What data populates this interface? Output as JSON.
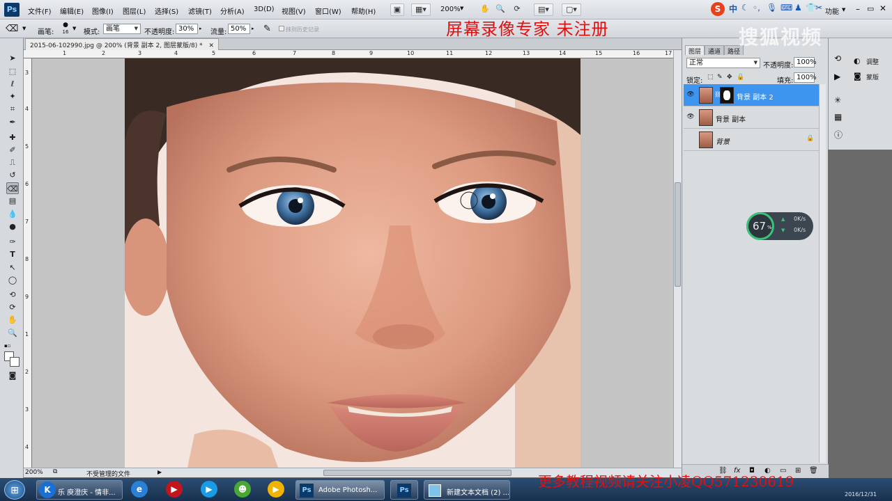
{
  "app": {
    "logo": "Ps"
  },
  "menubar": {
    "items": [
      "文件(F)",
      "编辑(E)",
      "图像(I)",
      "图层(L)",
      "选择(S)",
      "滤镜(T)",
      "分析(A)",
      "3D(D)",
      "视图(V)",
      "窗口(W)",
      "帮助(H)"
    ],
    "zoom": "200%",
    "right_label": "功能"
  },
  "options": {
    "tool_label": "画笔:",
    "brush_size": "16",
    "mode_label": "模式:",
    "mode_value": "画笔",
    "opacity_label": "不透明度:",
    "opacity_value": "30%",
    "flow_label": "流量:",
    "flow_value": "50%",
    "history_label": "抹到历史记录"
  },
  "watermark_top": "屏幕录像专家  未注册",
  "watermark_bottom": "更多教程视频请关注小凌QQ571230619",
  "sohu_watermark": "搜狐视频",
  "document": {
    "tab_title": "2015-06-102990.jpg @ 200% (背景 副本 2, 图层蒙版/8) *",
    "zoom_status": "200%",
    "status_text": "不受管理的文件"
  },
  "rulers": {
    "top": [
      "1",
      "2",
      "3",
      "4",
      "5",
      "6",
      "7",
      "8",
      "9",
      "10",
      "11",
      "12",
      "13",
      "14",
      "15",
      "16",
      "17"
    ],
    "left": [
      "3",
      "4",
      "5",
      "6",
      "7",
      "8",
      "9",
      "1",
      "2",
      "3",
      "4"
    ]
  },
  "layers": {
    "tabs": [
      "图层",
      "通道",
      "路径"
    ],
    "blend_mode": "正常",
    "opacity_label": "不透明度:",
    "opacity_value": "100%",
    "lock_label": "锁定:",
    "fill_label": "填充:",
    "fill_value": "100%",
    "items": [
      {
        "name": "背景 副本 2",
        "selected": true,
        "visible": true
      },
      {
        "name": "背景 副本",
        "selected": false,
        "visible": true
      },
      {
        "name": "背景",
        "selected": false,
        "visible": false
      }
    ]
  },
  "dock": {
    "adjust_label": "调整",
    "mask_label": "蒙版"
  },
  "netmeter": {
    "percent": "67",
    "percent_sign": "%",
    "up": "0K/s",
    "down": "0K/s"
  },
  "taskbar": {
    "items": [
      {
        "label": "乐 庾澄庆 - 情非..."
      },
      {
        "label": "Adobe Photosh..."
      },
      {
        "label": "新建文本文档 (2) ..."
      }
    ],
    "date": "2016/12/31"
  },
  "colors": {
    "selected_layer": "#3d95ef",
    "watermark_red": "#e31010",
    "taskbar": "#1f3b5e"
  }
}
